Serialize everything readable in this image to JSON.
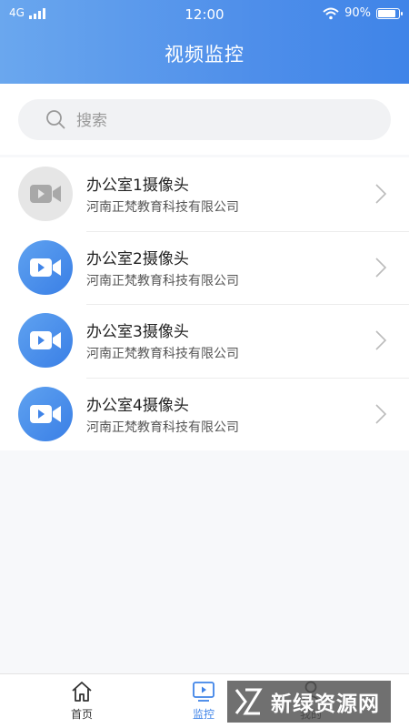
{
  "status_bar": {
    "network": "4G",
    "time": "12:00",
    "battery": "90%",
    "battery_level": 0.9
  },
  "header": {
    "title": "视频监控"
  },
  "search": {
    "placeholder": "搜索"
  },
  "cameras": [
    {
      "name": "办公室1摄像头",
      "org": "河南正梵教育科技有限公司",
      "status": "offline"
    },
    {
      "name": "办公室2摄像头",
      "org": "河南正梵教育科技有限公司",
      "status": "online"
    },
    {
      "name": "办公室3摄像头",
      "org": "河南正梵教育科技有限公司",
      "status": "online"
    },
    {
      "name": "办公室4摄像头",
      "org": "河南正梵教育科技有限公司",
      "status": "online"
    }
  ],
  "tabbar": {
    "tabs": [
      {
        "label": "首页",
        "icon": "home-icon",
        "active": false
      },
      {
        "label": "监控",
        "icon": "monitor-icon",
        "active": true
      },
      {
        "label": "我的",
        "icon": "user-icon",
        "active": false
      }
    ]
  },
  "watermark": {
    "text": "新绿资源网"
  },
  "colors": {
    "accent": "#3f84e8",
    "camera_offline": "#e6e6e6"
  }
}
